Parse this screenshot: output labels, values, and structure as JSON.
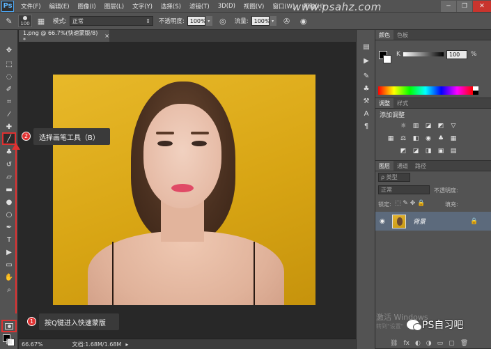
{
  "menubar": {
    "logo": "Ps",
    "items": [
      "文件(F)",
      "编辑(E)",
      "图像(I)",
      "图层(L)",
      "文字(Y)",
      "选择(S)",
      "滤镜(T)",
      "3D(D)",
      "视图(V)",
      "窗口(W)",
      "帮助(H)"
    ],
    "watermark": "www.psahz.com",
    "window_controls": [
      "─",
      "❐",
      "✕"
    ]
  },
  "options_bar": {
    "brush_size": "100",
    "mode_label": "模式:",
    "mode_value": "正常",
    "opacity_label": "不透明度:",
    "opacity_value": "100%",
    "flow_label": "流量:",
    "flow_value": "100%"
  },
  "document": {
    "tab_label": "1.png @ 66.7%(快速蒙版/8) *",
    "tab_close": "×"
  },
  "annotations": {
    "step2_number": "2",
    "step2_text": "选择画笔工具（B）",
    "step1_number": "1",
    "step1_text": "按Q键进入快速蒙版",
    "accent_color": "#e03131"
  },
  "statusbar": {
    "zoom": "66.67%",
    "doc_info": "文档:1.68M/1.68M"
  },
  "color_panel": {
    "tabs": [
      "颜色",
      "色板"
    ],
    "channel_label": "K",
    "value": "100",
    "unit": "%"
  },
  "adjust_panel": {
    "tabs": [
      "调整",
      "样式"
    ],
    "heading": "添加调整"
  },
  "layers_panel": {
    "tabs": [
      "图层",
      "通道",
      "路径"
    ],
    "kind_placeholder": "ρ 类型",
    "blend_mode": "正常",
    "opacity_label": "不透明度:",
    "lock_label": "锁定:",
    "fill_label": "填充:",
    "layer_name": "背景"
  },
  "overlay": {
    "activate_windows": "激活 Windows",
    "activate_sub": "转到\"设置\"",
    "wechat_brand": "PS自习吧"
  }
}
